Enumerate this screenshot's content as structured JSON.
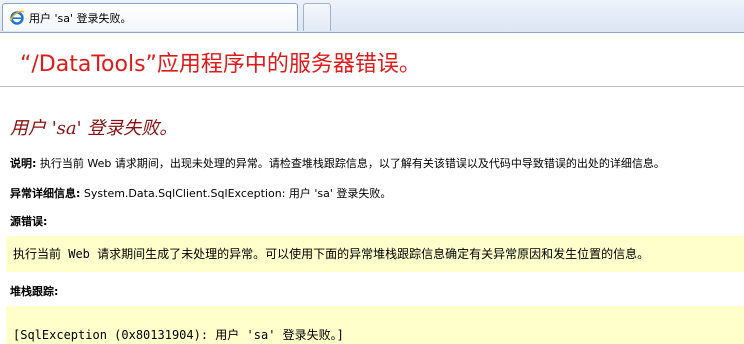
{
  "browser": {
    "tab_title": "用户 'sa' 登录失败。"
  },
  "page": {
    "title": "“/DataTools”应用程序中的服务器错误。",
    "error_heading": "用户 'sa' 登录失败。",
    "description_label": "说明:",
    "description_text": " 执行当前 Web 请求期间，出现未处理的异常。请检查堆栈跟踪信息，以了解有关该错误以及代码中导致错误的出处的详细信息。",
    "exception_label": "异常详细信息:",
    "exception_text": " System.Data.SqlClient.SqlException: 用户 'sa' 登录失败。",
    "source_error_label": "源错误:",
    "source_error_text": "执行当前 Web 请求期间生成了未处理的异常。可以使用下面的异常堆栈跟踪信息确定有关异常原因和发生位置的信息。",
    "stack_trace_label": "堆栈跟踪:",
    "stack_trace_text": "[SqlException (0x80131904): 用户 'sa' 登录失败。]"
  },
  "colors": {
    "title": "#e01b1b",
    "heading": "#8b0e0e",
    "code_background": "#ffffcc"
  },
  "icons": {
    "tab_icon": "ie-page-icon"
  }
}
